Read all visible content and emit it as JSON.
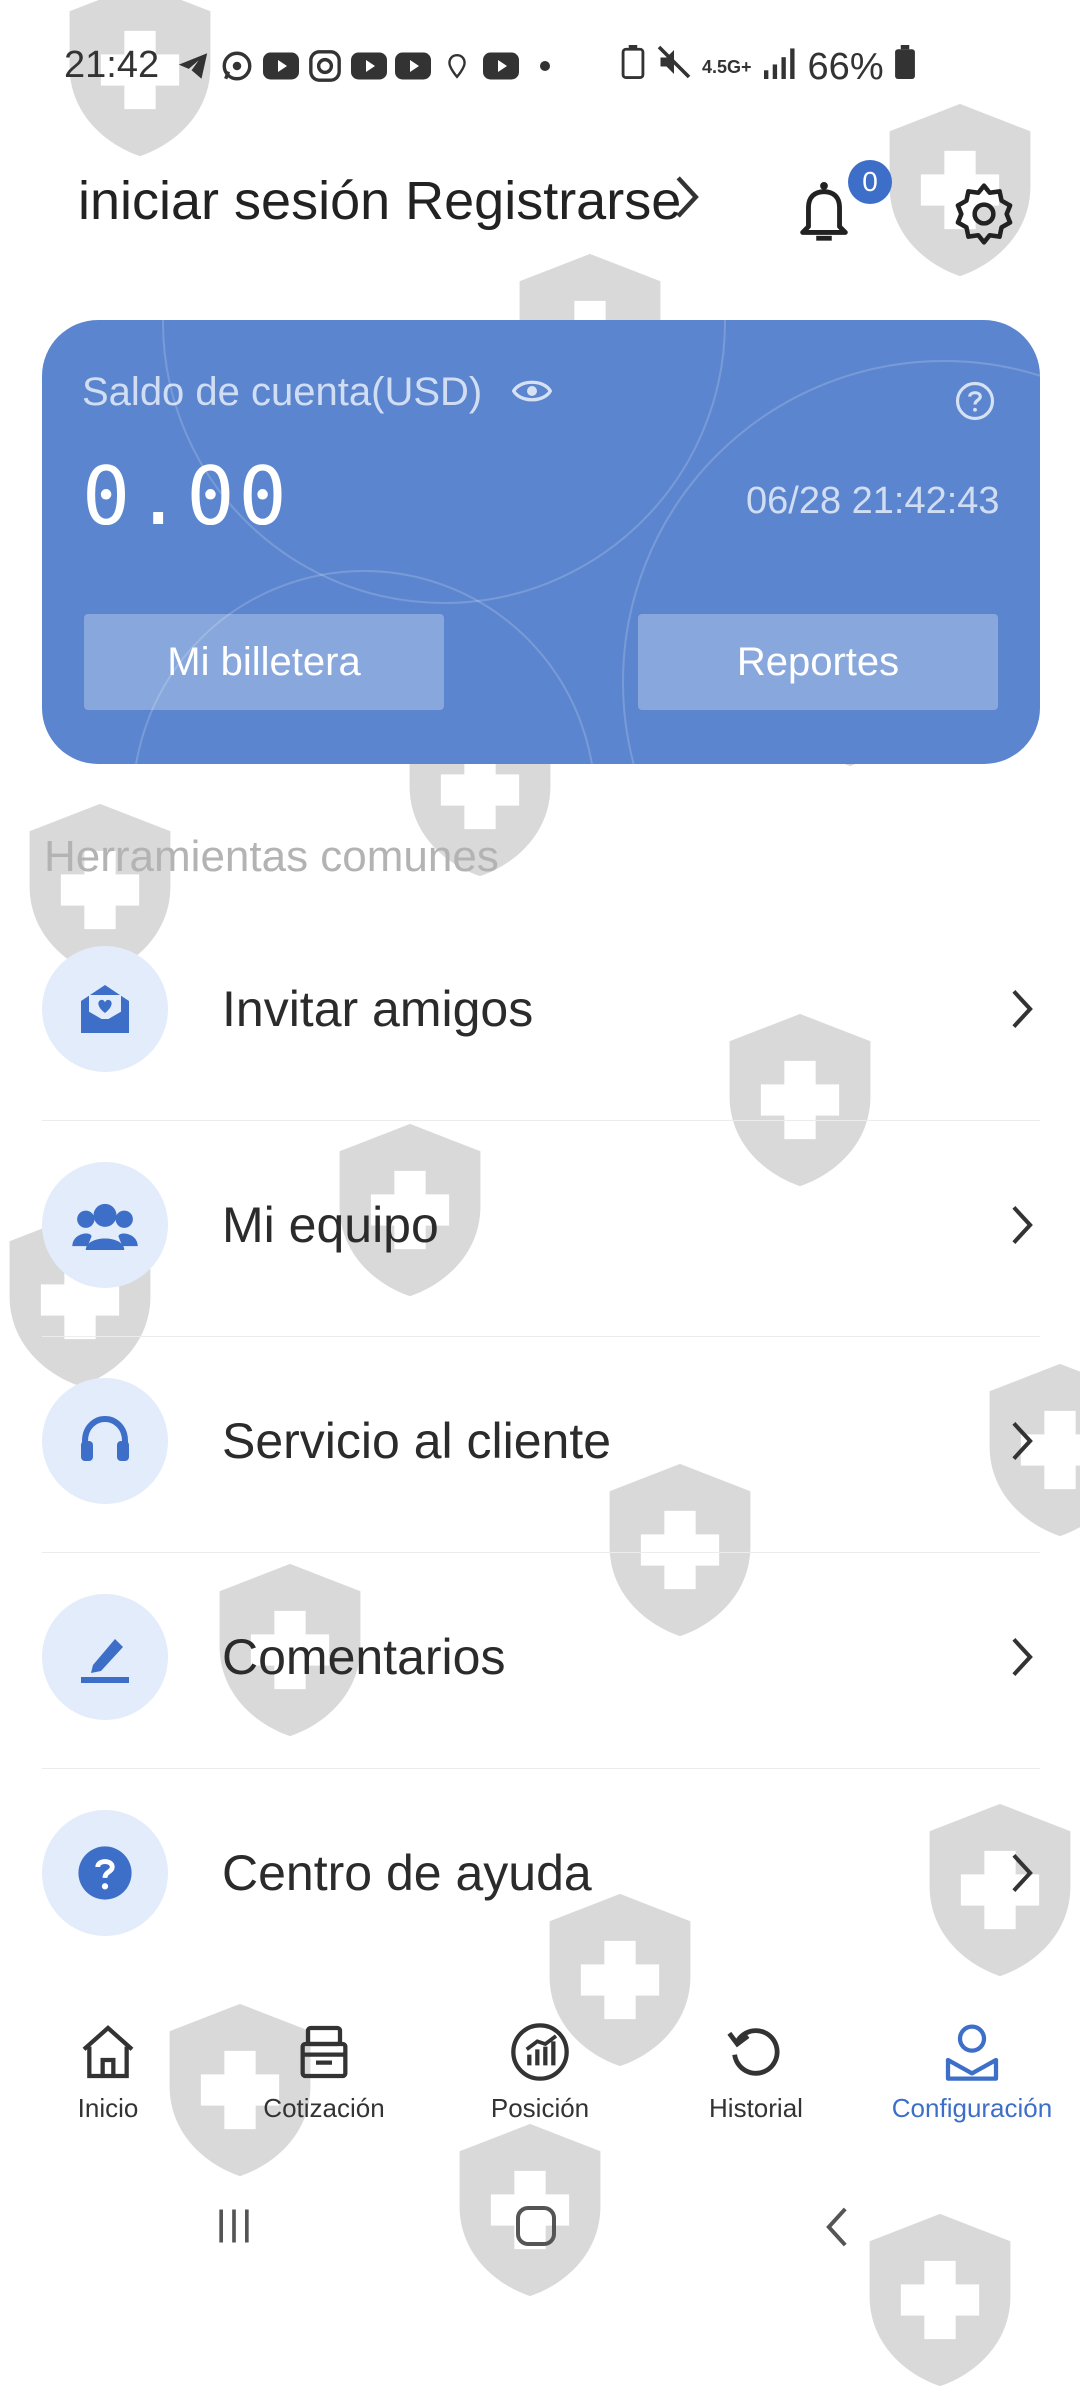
{
  "status_bar": {
    "time": "21:42",
    "network": "4.5G+",
    "battery": "66%",
    "notification_icons": [
      "telegram-icon",
      "whatsapp-icon",
      "youtube-icon",
      "instagram-icon",
      "youtube-icon",
      "youtube-icon",
      "location-icon",
      "youtube-icon",
      "dot-icon"
    ]
  },
  "header": {
    "login_text": "iniciar sesión Registrarse",
    "notification_count": "0"
  },
  "account_card": {
    "label": "Saldo de cuenta(USD)",
    "amount": "0.00",
    "timestamp": "06/28 21:42:43",
    "wallet_button": "Mi billetera",
    "reports_button": "Reportes",
    "background_color": "#5b86cf"
  },
  "tools": {
    "section_title": "Herramientas comunes",
    "items": [
      {
        "label": "Invitar amigos",
        "icon": "envelope-heart-icon"
      },
      {
        "label": "Mi equipo",
        "icon": "team-icon"
      },
      {
        "label": "Servicio al cliente",
        "icon": "headset-icon"
      },
      {
        "label": "Comentarios",
        "icon": "edit-icon"
      },
      {
        "label": "Centro de ayuda",
        "icon": "question-icon"
      }
    ]
  },
  "tab_bar": {
    "active_color": "#3d6fc9",
    "items": [
      {
        "label": "Inicio",
        "icon": "home-icon"
      },
      {
        "label": "Cotización",
        "icon": "quote-icon"
      },
      {
        "label": "Posición",
        "icon": "position-icon"
      },
      {
        "label": "Historial",
        "icon": "history-icon"
      },
      {
        "label": "Configuración",
        "icon": "profile-icon",
        "active": true
      }
    ]
  }
}
